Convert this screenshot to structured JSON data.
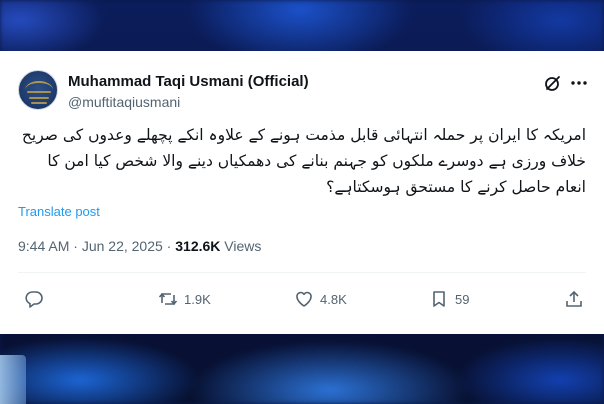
{
  "author": {
    "display_name": "Muhammad Taqi Usmani (Official)",
    "handle": "@muftitaqiusmani"
  },
  "tweet": {
    "text": "امریکہ کا ایران پر حملہ انتہائی قابل مذمت ہونے کے علاوہ انکے پچھلے وعدوں کی صریح خلاف ورزی ہے دوسرے ملکوں کو جہنم بنانے کی دھمکیاں دینے والا شخص کیا امن کا انعام حاصل کرنے کا مستحق ہوسکتاہے؟",
    "translate_label": "Translate post"
  },
  "meta": {
    "time": "9:44 AM",
    "separator": " · ",
    "date": "Jun 22, 2025",
    "views_count": "312.6K",
    "views_label": " Views"
  },
  "actions": {
    "reply": {
      "icon": "reply-icon",
      "count": ""
    },
    "repost": {
      "icon": "repost-icon",
      "count": "1.9K"
    },
    "like": {
      "icon": "heart-icon",
      "count": "4.8K"
    },
    "bookmark": {
      "icon": "bookmark-icon",
      "count": "59"
    },
    "share": {
      "icon": "share-icon",
      "count": ""
    }
  },
  "colors": {
    "text_primary": "#0f1419",
    "text_secondary": "#536471",
    "link": "#1d9bf0"
  }
}
